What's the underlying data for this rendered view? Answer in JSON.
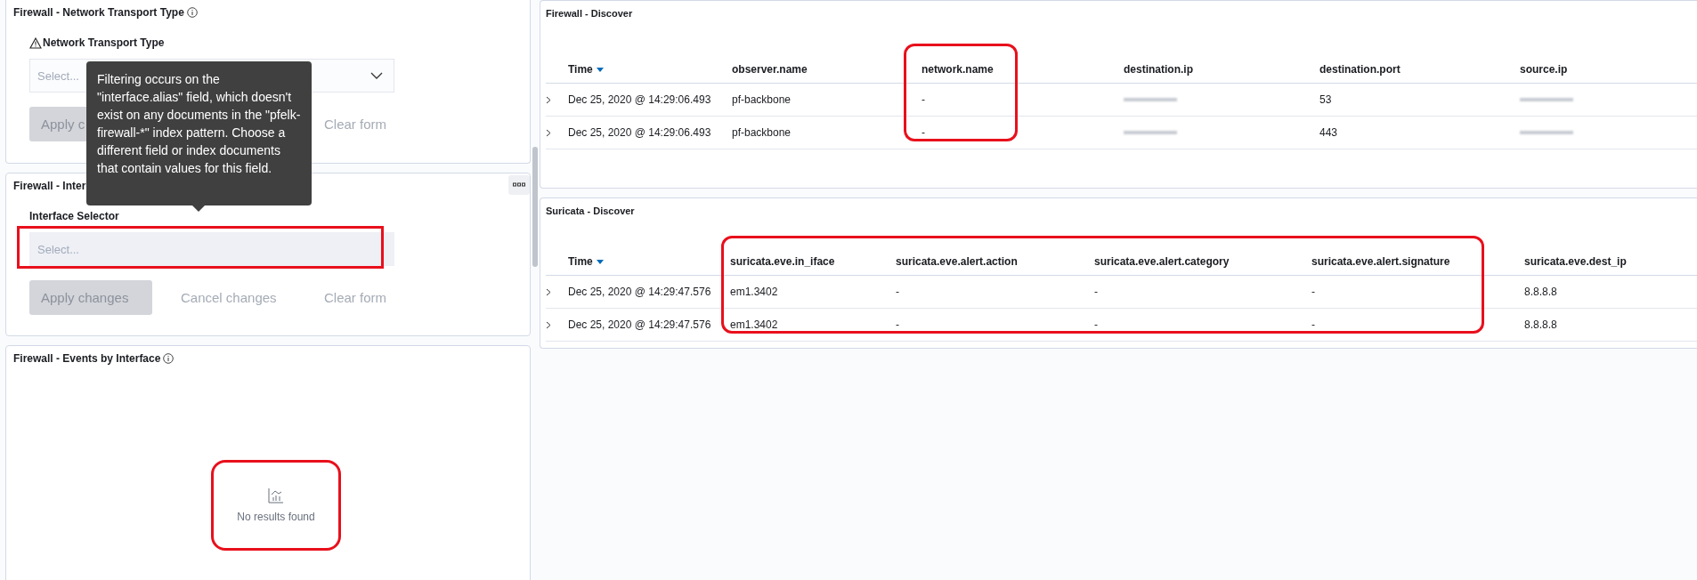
{
  "controls_panels": [
    {
      "title": "Firewall - Network Transport Type",
      "info": true,
      "field_label": "Network Transport Type",
      "warning": true,
      "placeholder": "Select...",
      "dropdown": true,
      "options_menu": false,
      "buttons": [
        {
          "label": "Apply c",
          "kind": "apply",
          "disabled": true
        },
        {
          "label": "Clear form",
          "kind": "clear",
          "disabled": true
        }
      ]
    },
    {
      "title": "Firewall - Inter",
      "info": false,
      "field_label": "Interface Selector",
      "warning": false,
      "placeholder": "Select...",
      "dropdown": false,
      "options_menu": true,
      "buttons": [
        {
          "label": "Apply changes",
          "kind": "apply",
          "disabled": true
        },
        {
          "label": "Cancel changes",
          "kind": "cancel",
          "disabled": true
        },
        {
          "label": "Clear form",
          "kind": "clear",
          "disabled": true
        }
      ]
    }
  ],
  "tooltip": {
    "text": "Filtering occurs on the \"interface.alias\" field, which doesn't exist on any documents in the \"pfelk-firewall-*\" index pattern. Choose a different field or index documents that contain values for this field."
  },
  "events_panel": {
    "title": "Firewall - Events by Interface",
    "info": true,
    "message": "No results found"
  },
  "discover_panels": [
    {
      "title": "Firewall - Discover",
      "columns": [
        "Time",
        "observer.name",
        "network.name",
        "destination.ip",
        "destination.port",
        "source.ip"
      ],
      "rows": [
        {
          "cells": [
            "Dec 25, 2020 @ 14:29:06.493",
            "pf-backbone",
            "-",
            null,
            "53",
            null
          ]
        },
        {
          "cells": [
            "Dec 25, 2020 @ 14:29:06.493",
            "pf-backbone",
            "-",
            null,
            "443",
            null
          ]
        }
      ]
    },
    {
      "title": "Suricata - Discover",
      "columns": [
        "Time",
        "suricata.eve.in_iface",
        "suricata.eve.alert.action",
        "suricata.eve.alert.category",
        "suricata.eve.alert.signature",
        "suricata.eve.dest_ip"
      ],
      "rows": [
        {
          "cells": [
            "Dec 25, 2020 @ 14:29:47.576",
            "em1.3402",
            "-",
            "-",
            "-",
            "8.8.8.8"
          ]
        },
        {
          "cells": [
            "Dec 25, 2020 @ 14:29:47.576",
            "em1.3402",
            "-",
            "-",
            "-",
            "8.8.8.8"
          ]
        }
      ]
    }
  ]
}
